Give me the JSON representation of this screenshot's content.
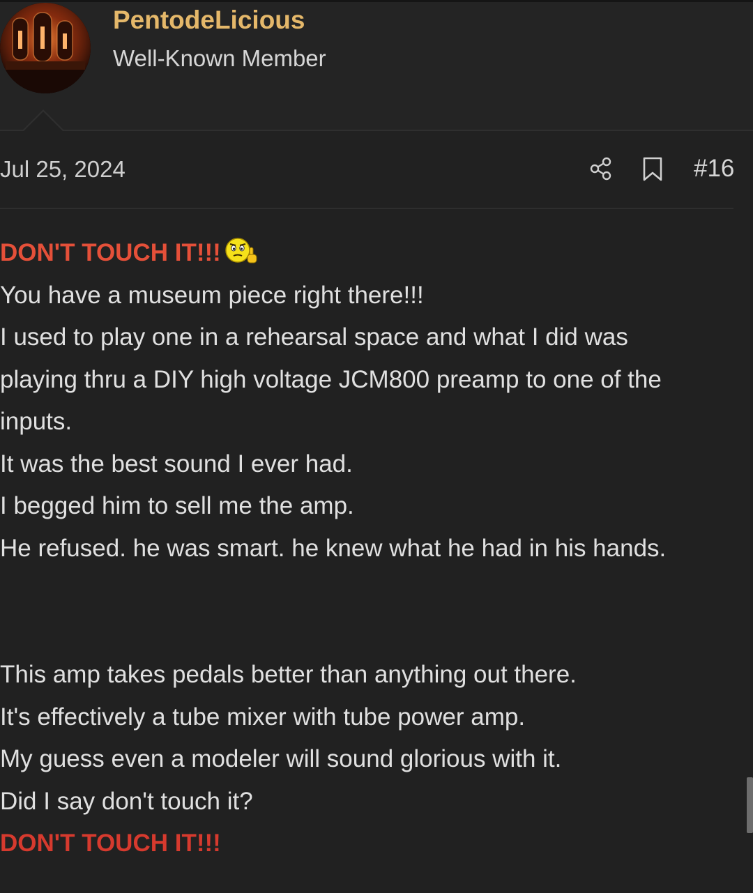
{
  "user": {
    "name": "PentodeLicious",
    "title": "Well-Known Member",
    "avatar_icon": "vacuum-tube-avatar"
  },
  "post": {
    "date": "Jul 25, 2024",
    "number": "#16",
    "share_icon": "share-icon",
    "bookmark_icon": "bookmark-icon",
    "emoji_icon": "angry-middle-finger-emoji"
  },
  "body": {
    "line1": "DON'T TOUCH IT!!!",
    "line2": "You have a museum piece right there!!!",
    "line3": "I used to play one in a rehearsal space and what I did was",
    "line4": "playing thru a DIY high voltage JCM800 preamp to one of the",
    "line5": "inputs.",
    "line6": "It was the best sound I ever had.",
    "line7": "I begged him to sell me the amp.",
    "line8": "He refused. he was smart. he knew what he had in his hands.",
    "line9": "This amp takes pedals better than anything out there.",
    "line10": "It's effectively a tube mixer with tube power amp.",
    "line11": "My guess even a modeler will sound glorious with it.",
    "line12": "Did I say don't touch it?",
    "line13": "DON'T TOUCH IT!!!"
  },
  "colors": {
    "background": "#212121",
    "username": "#e5b86a",
    "emphasis": "#e55039"
  }
}
